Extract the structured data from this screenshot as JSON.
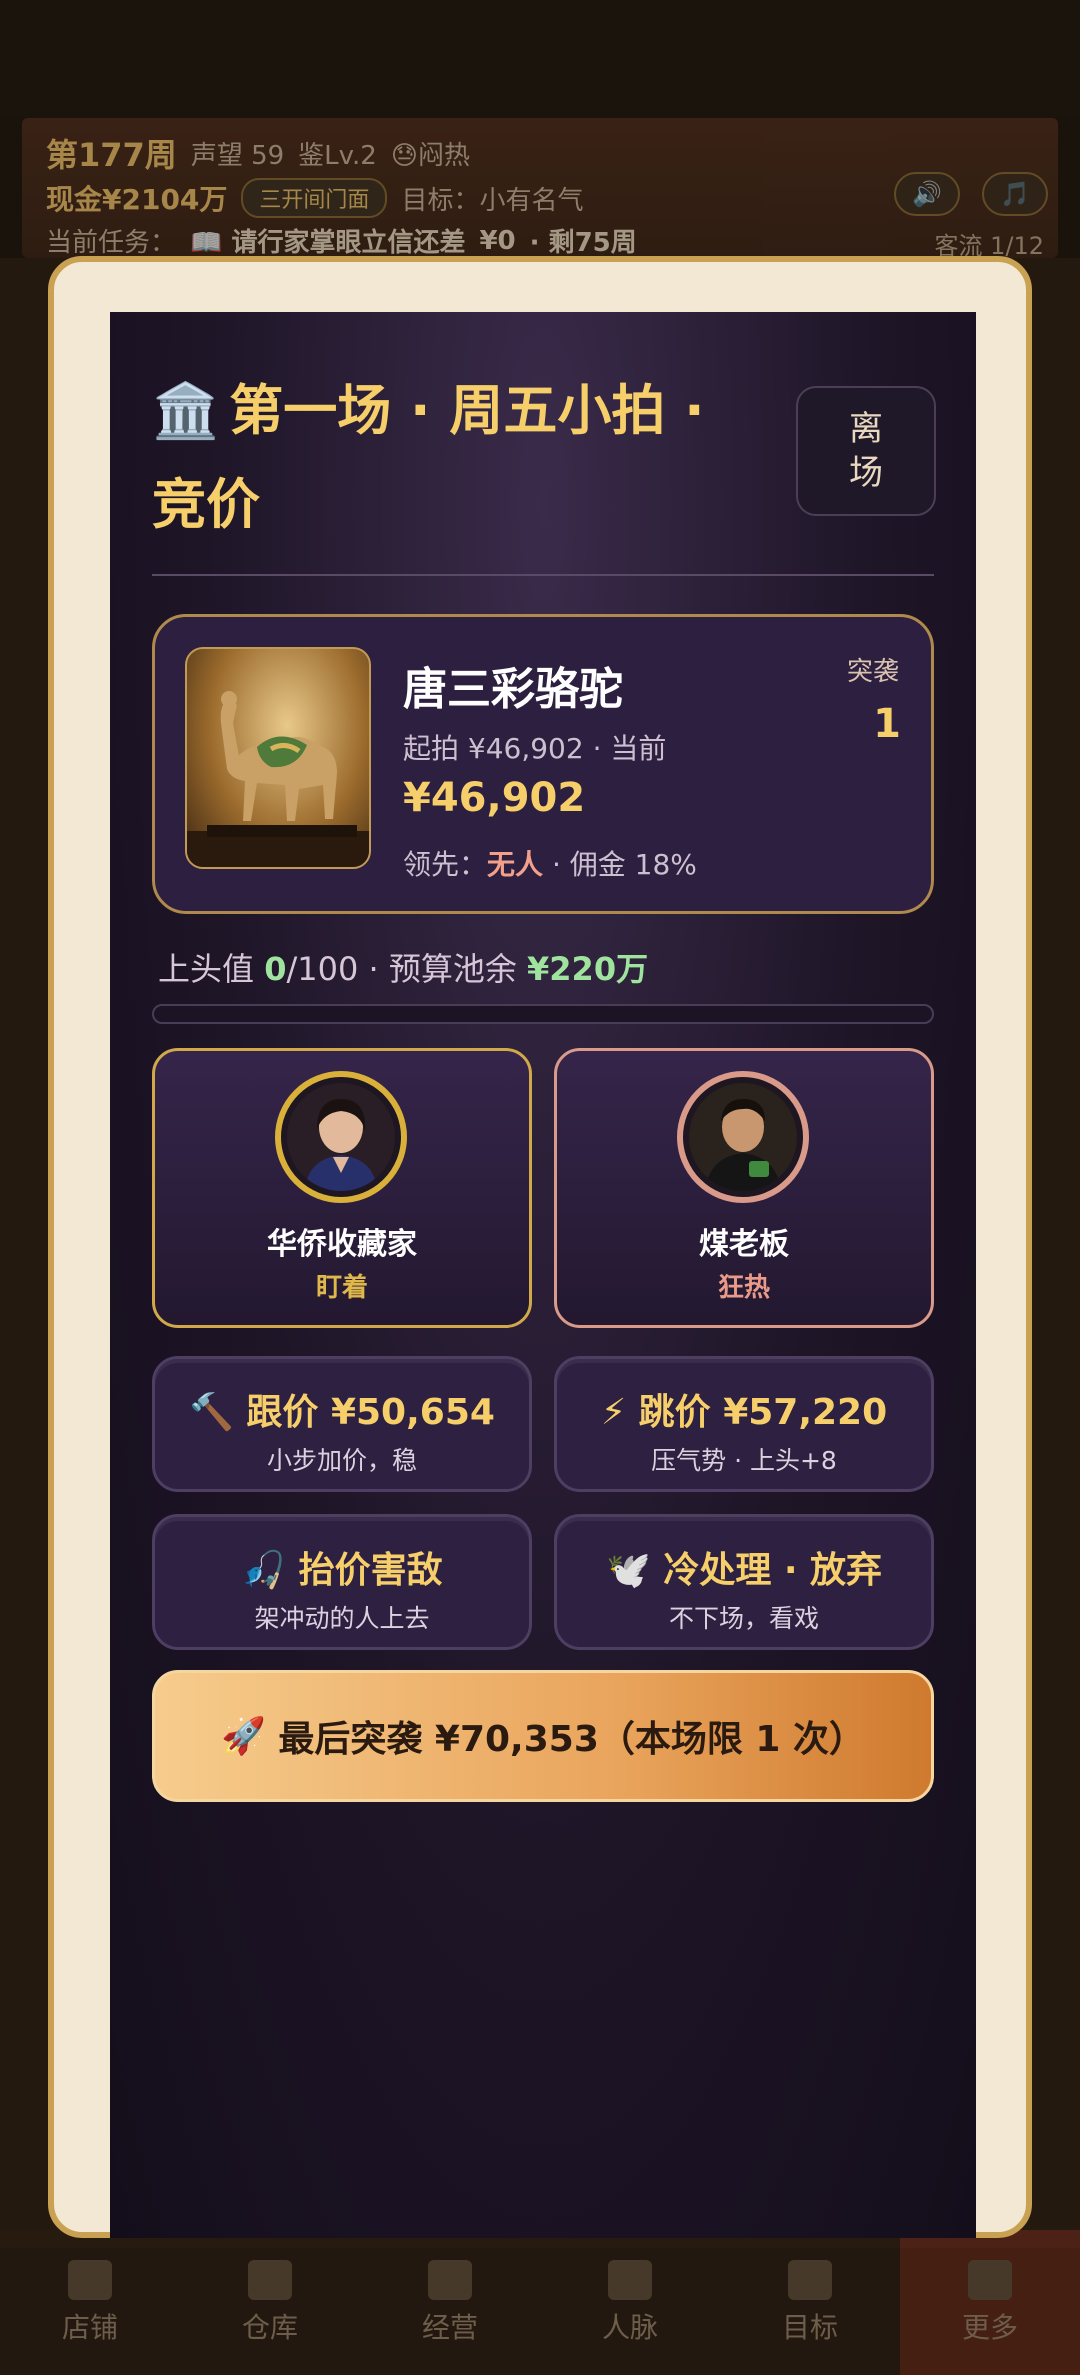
{
  "hud": {
    "week": "第177周",
    "reputation": "声望 59",
    "appraisal": "鉴Lv.2",
    "mood": "😓闷热",
    "cash": "现金¥2104万",
    "shop_badge": "三开间门面",
    "goal": "目标：小有名气",
    "task_prefix": "当前任务：",
    "task": "📖 请行家掌眼立信还差",
    "task_value": "¥0",
    "task_suffix": "· 剩75周",
    "visitors": "客流 1/12",
    "sound_icon": "🔊",
    "music_icon": "🎵"
  },
  "nav": {
    "items": [
      {
        "label": "店铺",
        "icon": "shop-icon"
      },
      {
        "label": "仓库",
        "icon": "warehouse-icon"
      },
      {
        "label": "经营",
        "icon": "manage-icon"
      },
      {
        "label": "人脉",
        "icon": "people-icon"
      },
      {
        "label": "目标",
        "icon": "goal-icon"
      },
      {
        "label": "更多",
        "icon": "more-icon"
      }
    ]
  },
  "modal": {
    "title_icon": "🏛️",
    "title": "第一场 · 周五小拍 · 竞价",
    "leave_label": "离场",
    "item": {
      "name": "唐三彩骆驼",
      "start_text": "起拍 ¥46,902 · 当前",
      "current_price": "¥46,902",
      "lead_prefix": "领先：",
      "lead_who": "无人",
      "lead_suffix": "· 佣金 18%",
      "raid_label": "突袭",
      "raid_count": "1"
    },
    "stats": {
      "heat_prefix": "上头值 ",
      "heat_value": "0",
      "heat_max": "/100 · 预算池余 ",
      "budget": "¥220万",
      "heat_fraction": 0.0
    },
    "rivals": [
      {
        "name": "华侨收藏家",
        "state": "盯着",
        "border": "#d1a94a"
      },
      {
        "name": "煤老板",
        "state": "狂热",
        "border": "#d99a8a"
      }
    ],
    "actions": [
      {
        "icon": "🔨",
        "main": "跟价 ¥50,654",
        "sub": "小步加价，稳"
      },
      {
        "icon": "⚡",
        "main": "跳价 ¥57,220",
        "sub": "压气势 · 上头+8"
      },
      {
        "icon": "🎣",
        "main": "抬价害敌",
        "sub": "架冲动的人上去"
      },
      {
        "icon": "🕊️",
        "main": "冷处理 · 放弃",
        "sub": "不下场，看戏"
      }
    ],
    "final": {
      "icon": "🚀",
      "label": "最后突袭 ¥70,353（本场限 1 次）"
    }
  }
}
